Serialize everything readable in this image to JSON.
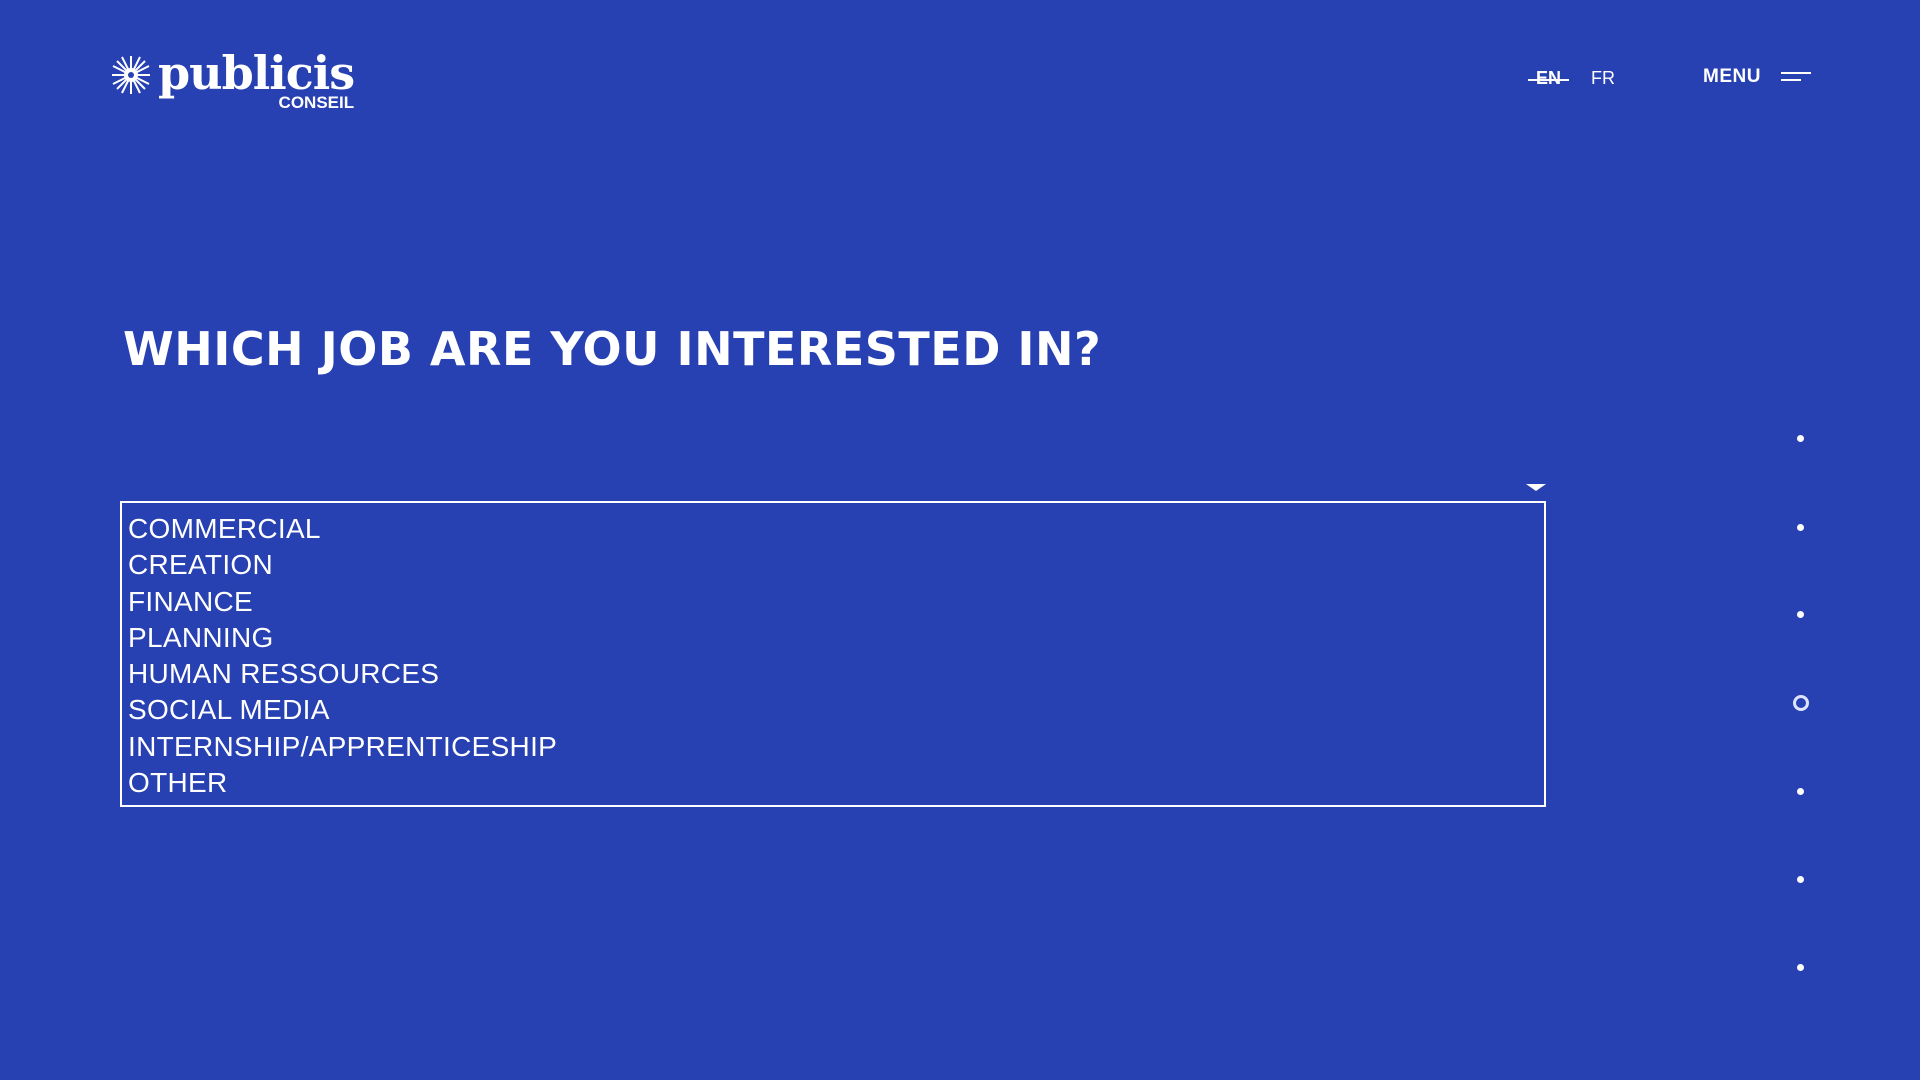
{
  "header": {
    "logo_word": "publicis",
    "logo_sub": "CONSEIL",
    "languages": [
      "EN",
      "FR"
    ],
    "active_language": "EN",
    "menu_label": "MENU"
  },
  "question": {
    "title": "WHICH JOB ARE YOU INTERESTED IN?"
  },
  "job_select": {
    "options": [
      "COMMERCIAL",
      "CREATION",
      "FINANCE",
      "PLANNING",
      "HUMAN RESSOURCES",
      "SOCIAL MEDIA",
      "INTERNSHIP/APPRENTICESHIP",
      "OTHER"
    ]
  },
  "side_nav": {
    "active_step": 4,
    "total_steps": 7
  },
  "colors": {
    "background": "#2740b2",
    "foreground": "#ffffff"
  },
  "icons": {
    "logo": "starburst-logo-icon",
    "menu": "hamburger-icon",
    "dropdown": "caret-down-icon"
  }
}
